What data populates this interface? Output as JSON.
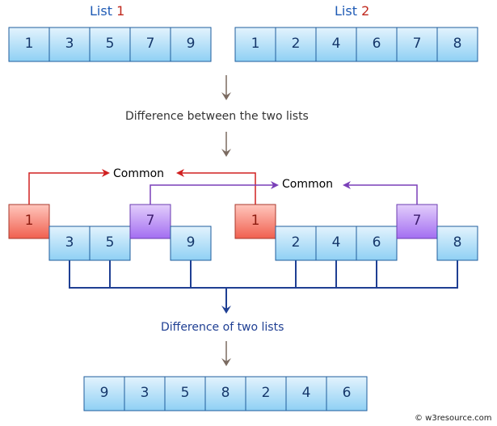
{
  "list1_header": {
    "prefix": "List ",
    "number": "1"
  },
  "list2_header": {
    "prefix": "List ",
    "number": "2"
  },
  "list1_values": [
    "1",
    "3",
    "5",
    "7",
    "9"
  ],
  "list2_values": [
    "1",
    "2",
    "4",
    "6",
    "7",
    "8"
  ],
  "step1_text": "Difference between the two lists",
  "common_label_red": "Common",
  "common_label_purple": "Common",
  "split_list1": [
    {
      "value": "1",
      "kind": "common-red"
    },
    {
      "value": "3",
      "kind": "unique"
    },
    {
      "value": "5",
      "kind": "unique"
    },
    {
      "value": "7",
      "kind": "common-purple"
    },
    {
      "value": "9",
      "kind": "unique"
    }
  ],
  "split_list2": [
    {
      "value": "1",
      "kind": "common-red"
    },
    {
      "value": "2",
      "kind": "unique"
    },
    {
      "value": "4",
      "kind": "unique"
    },
    {
      "value": "6",
      "kind": "unique"
    },
    {
      "value": "7",
      "kind": "common-purple"
    },
    {
      "value": "8",
      "kind": "unique"
    }
  ],
  "step2_text": "Difference of two lists",
  "result_values": [
    "9",
    "3",
    "5",
    "8",
    "2",
    "4",
    "6"
  ],
  "footer_text": "© w3resource.com",
  "colors": {
    "cell_blue_top": "#e3f3fd",
    "cell_blue_bottom": "#8fd0f4",
    "cell_red_top": "#ffc6bd",
    "cell_red_bottom": "#f0604f",
    "cell_purple_top": "#e2cdfb",
    "cell_purple_bottom": "#a36ef1",
    "arrow_gray": "#7a6a60",
    "red_line": "#d02020",
    "purple_line": "#7a3fb8",
    "bracket_blue": "#1f3f93"
  }
}
